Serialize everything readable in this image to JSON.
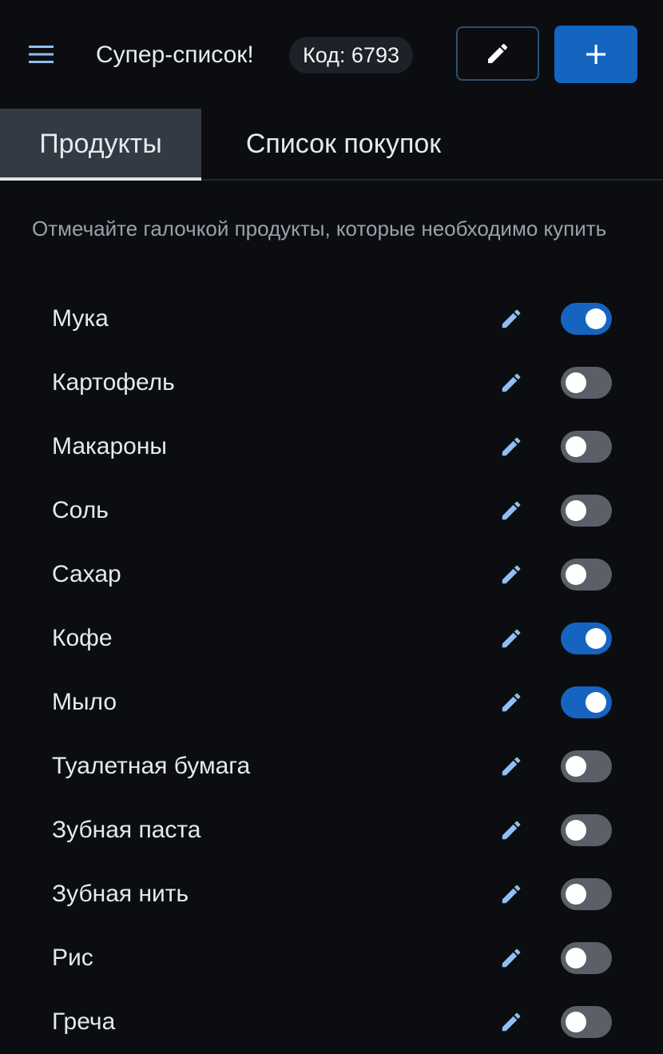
{
  "header": {
    "title": "Супер-список!",
    "code_badge": "Код: 6793",
    "menu_icon": "hamburger-menu-icon",
    "edit_icon": "pencil-icon",
    "add_icon": "plus-icon"
  },
  "tabs": [
    {
      "label": "Продукты",
      "active": true
    },
    {
      "label": "Список покупок",
      "active": false
    }
  ],
  "hint": "Отмечайте галочкой продукты, которые необходимо купить",
  "products": [
    {
      "name": "Мука",
      "checked": true
    },
    {
      "name": "Картофель",
      "checked": false
    },
    {
      "name": "Макароны",
      "checked": false
    },
    {
      "name": "Соль",
      "checked": false
    },
    {
      "name": "Сахар",
      "checked": false
    },
    {
      "name": "Кофе",
      "checked": true
    },
    {
      "name": "Мыло",
      "checked": true
    },
    {
      "name": "Туалетная бумага",
      "checked": false
    },
    {
      "name": "Зубная паста",
      "checked": false
    },
    {
      "name": "Зубная нить",
      "checked": false
    },
    {
      "name": "Рис",
      "checked": false
    },
    {
      "name": "Греча",
      "checked": false
    }
  ],
  "colors": {
    "background": "#0b0d10",
    "accent": "#1565c0",
    "pencil": "#90bff0",
    "toggle_off": "#5a5f68"
  }
}
